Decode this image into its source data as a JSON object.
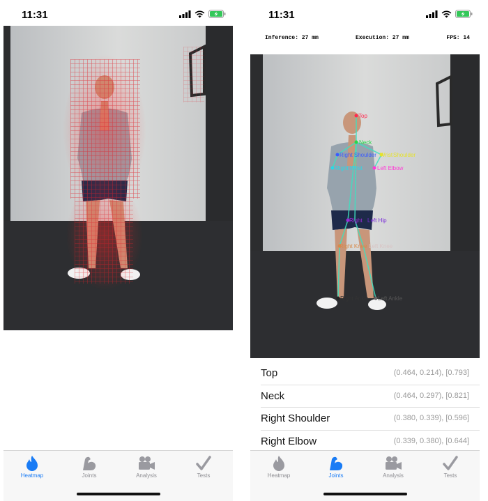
{
  "screens": [
    {
      "status": {
        "time": "11:31"
      },
      "tabs": [
        {
          "label": "Heatmap",
          "icon": "flame-icon",
          "active": true
        },
        {
          "label": "Joints",
          "icon": "flexed-arm-icon",
          "active": false
        },
        {
          "label": "Analysis",
          "icon": "video-camera-icon",
          "active": false
        },
        {
          "label": "Tests",
          "icon": "checkmark-icon",
          "active": false
        }
      ]
    },
    {
      "status": {
        "time": "11:31"
      },
      "metrics": {
        "inference": "Inference: 27 mm",
        "execution": "Execution: 27 mm",
        "fps": "FPS: 14"
      },
      "keypoint_labels": [
        "Top",
        "Neck",
        "Right Shoulder",
        "Wrist",
        "Shoulder",
        "Right Wrist",
        "Left Elbow",
        "Right",
        "Left Hip",
        "Right Knee",
        "Left Knee",
        "Right Ankle",
        "Left Ankle"
      ],
      "joints": [
        {
          "name": "Top",
          "value": "(0.464, 0.214), [0.793]"
        },
        {
          "name": "Neck",
          "value": "(0.464, 0.297), [0.821]"
        },
        {
          "name": "Right Shoulder",
          "value": "(0.380, 0.339), [0.596]"
        },
        {
          "name": "Right Elbow",
          "value": "(0.339, 0.380), [0.644]"
        }
      ],
      "tabs": [
        {
          "label": "Heatmap",
          "icon": "flame-icon",
          "active": false
        },
        {
          "label": "Joints",
          "icon": "flexed-arm-icon",
          "active": true
        },
        {
          "label": "Analysis",
          "icon": "video-camera-icon",
          "active": false
        },
        {
          "label": "Tests",
          "icon": "checkmark-icon",
          "active": false
        }
      ]
    }
  ],
  "colors": {
    "accent": "#1a7cf5",
    "heatmap": "#e0202a",
    "battery": "#34c759"
  }
}
